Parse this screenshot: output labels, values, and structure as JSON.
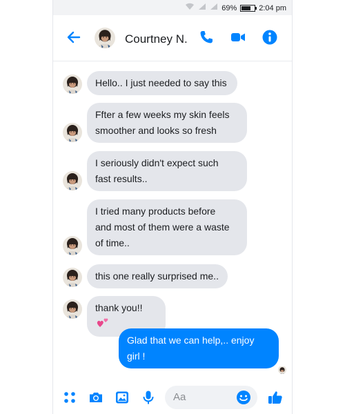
{
  "status_bar": {
    "battery_percent": "69%",
    "time": "2:04 pm"
  },
  "header": {
    "contact_name": "Courtney N."
  },
  "messages": [
    {
      "sender": "incoming",
      "text_lines": [
        "Hello.. I just needed to say this"
      ]
    },
    {
      "sender": "incoming",
      "text_lines": [
        "Ffter a few weeks my skin feels",
        "smoother and looks so fresh"
      ]
    },
    {
      "sender": "incoming",
      "text_lines": [
        "I seriously didn't expect such",
        "fast results.."
      ]
    },
    {
      "sender": "incoming",
      "text_lines": [
        "I tried many products before",
        "and most of them were a waste",
        "of time.."
      ]
    },
    {
      "sender": "incoming",
      "text_lines": [
        "this one really surprised me.."
      ]
    },
    {
      "sender": "incoming",
      "text_lines": [
        "thank you!!"
      ],
      "emoji": "pink-hearts-icon"
    },
    {
      "sender": "outgoing",
      "text_lines": [
        "Glad that we can help,.. enjoy",
        "girl !"
      ]
    }
  ],
  "composer": {
    "placeholder": "Aa"
  },
  "colors": {
    "accent": "#0084ff",
    "incoming_bubble": "#e4e6eb",
    "outgoing_bubble": "#0084ff"
  },
  "icons": {
    "status": [
      "wifi-icon",
      "signal-icon",
      "signal-icon-2",
      "battery-icon"
    ],
    "header": [
      "back-arrow-icon",
      "phone-icon",
      "video-camera-icon",
      "info-icon"
    ],
    "composer": [
      "apps-dots-icon",
      "camera-icon",
      "gallery-icon",
      "microphone-icon",
      "emoji-icon",
      "thumbs-up-icon"
    ]
  }
}
